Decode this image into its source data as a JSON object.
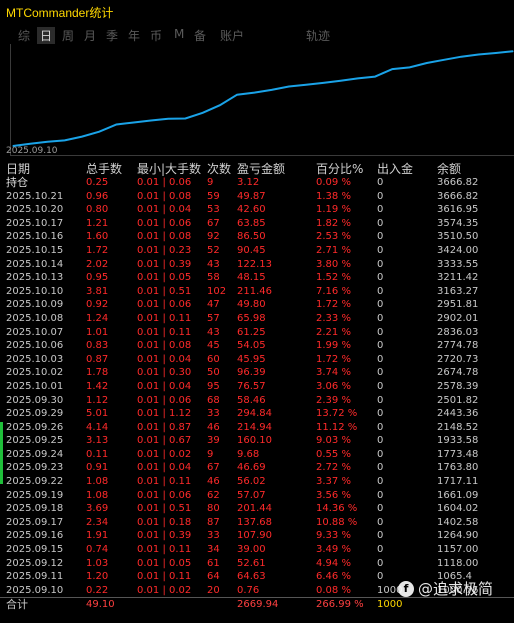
{
  "app": {
    "title": "MTCommander统计"
  },
  "tabs": [
    {
      "label": "综",
      "active": false
    },
    {
      "label": "日",
      "active": true
    },
    {
      "label": "周",
      "active": false
    },
    {
      "label": "月",
      "active": false
    },
    {
      "label": "季",
      "active": false
    },
    {
      "label": "年",
      "active": false
    },
    {
      "label": "币",
      "active": false
    },
    {
      "label": "M",
      "active": false
    },
    {
      "label": "备",
      "active": false
    },
    {
      "label": "账户",
      "active": false
    },
    {
      "label": "轨迹",
      "active": false
    }
  ],
  "chart": {
    "start_date": "2025.09.10",
    "line_color": "#1aa3e8"
  },
  "chart_data": {
    "type": "line",
    "x": [
      "2025.09.10",
      "2025.09.11",
      "2025.09.12",
      "2025.09.15",
      "2025.09.16",
      "2025.09.17",
      "2025.09.18",
      "2025.09.19",
      "2025.09.22",
      "2025.09.23",
      "2025.09.24",
      "2025.09.25",
      "2025.09.26",
      "2025.09.29",
      "2025.09.30",
      "2025.10.01",
      "2025.10.02",
      "2025.10.03",
      "2025.10.06",
      "2025.10.07",
      "2025.10.08",
      "2025.10.09",
      "2025.10.10",
      "2025.10.13",
      "2025.10.14",
      "2025.10.15",
      "2025.10.16",
      "2025.10.17",
      "2025.10.20",
      "2025.10.21"
    ],
    "series": [
      {
        "values": [
          1000.76,
          1065.4,
          1118.0,
          1157.0,
          1264.9,
          1402.58,
          1604.02,
          1661.09,
          1717.11,
          1763.8,
          1773.48,
          1933.58,
          2148.52,
          2443.36,
          2501.82,
          2578.39,
          2674.78,
          2720.73,
          2774.78,
          2836.03,
          2902.01,
          2951.81,
          3163.27,
          3211.42,
          3333.55,
          3424.0,
          3510.5,
          3574.35,
          3616.95,
          3666.82
        ]
      }
    ],
    "ylim": [
      1000,
      3700
    ]
  },
  "table": {
    "headers": {
      "date": "日期",
      "lots": "总手数",
      "range": "最小|大手数",
      "count": "次数",
      "pl": "盈亏金额",
      "pct": "百分比%",
      "io": "出入金",
      "balance": "余额"
    },
    "holding": {
      "label": "持仓",
      "lots": "0.25",
      "range": "0.01 | 0.06",
      "count": "9",
      "pl": "3.12",
      "pct": "0.09 %",
      "io": "0",
      "balance": "3666.82"
    },
    "rows": [
      {
        "date": "2025.10.21",
        "lots": "0.96",
        "range": "0.01 | 0.08",
        "count": "59",
        "pl": "49.87",
        "pct": "1.38 %",
        "io": "0",
        "balance": "3666.82"
      },
      {
        "date": "2025.10.20",
        "lots": "0.80",
        "range": "0.01 | 0.04",
        "count": "53",
        "pl": "42.60",
        "pct": "1.19 %",
        "io": "0",
        "balance": "3616.95"
      },
      {
        "date": "2025.10.17",
        "lots": "1.21",
        "range": "0.01 | 0.06",
        "count": "67",
        "pl": "63.85",
        "pct": "1.82 %",
        "io": "0",
        "balance": "3574.35"
      },
      {
        "date": "2025.10.16",
        "lots": "1.60",
        "range": "0.01 | 0.08",
        "count": "92",
        "pl": "86.50",
        "pct": "2.53 %",
        "io": "0",
        "balance": "3510.50"
      },
      {
        "date": "2025.10.15",
        "lots": "1.72",
        "range": "0.01 | 0.23",
        "count": "52",
        "pl": "90.45",
        "pct": "2.71 %",
        "io": "0",
        "balance": "3424.00"
      },
      {
        "date": "2025.10.14",
        "lots": "2.02",
        "range": "0.01 | 0.39",
        "count": "43",
        "pl": "122.13",
        "pct": "3.80 %",
        "io": "0",
        "balance": "3333.55"
      },
      {
        "date": "2025.10.13",
        "lots": "0.95",
        "range": "0.01 | 0.05",
        "count": "58",
        "pl": "48.15",
        "pct": "1.52 %",
        "io": "0",
        "balance": "3211.42"
      },
      {
        "date": "2025.10.10",
        "lots": "3.81",
        "range": "0.01 | 0.51",
        "count": "102",
        "pl": "211.46",
        "pct": "7.16 %",
        "io": "0",
        "balance": "3163.27"
      },
      {
        "date": "2025.10.09",
        "lots": "0.92",
        "range": "0.01 | 0.06",
        "count": "47",
        "pl": "49.80",
        "pct": "1.72 %",
        "io": "0",
        "balance": "2951.81"
      },
      {
        "date": "2025.10.08",
        "lots": "1.24",
        "range": "0.01 | 0.11",
        "count": "57",
        "pl": "65.98",
        "pct": "2.33 %",
        "io": "0",
        "balance": "2902.01"
      },
      {
        "date": "2025.10.07",
        "lots": "1.01",
        "range": "0.01 | 0.11",
        "count": "43",
        "pl": "61.25",
        "pct": "2.21 %",
        "io": "0",
        "balance": "2836.03"
      },
      {
        "date": "2025.10.06",
        "lots": "0.83",
        "range": "0.01 | 0.08",
        "count": "45",
        "pl": "54.05",
        "pct": "1.99 %",
        "io": "0",
        "balance": "2774.78"
      },
      {
        "date": "2025.10.03",
        "lots": "0.87",
        "range": "0.01 | 0.04",
        "count": "60",
        "pl": "45.95",
        "pct": "1.72 %",
        "io": "0",
        "balance": "2720.73"
      },
      {
        "date": "2025.10.02",
        "lots": "1.78",
        "range": "0.01 | 0.30",
        "count": "50",
        "pl": "96.39",
        "pct": "3.74 %",
        "io": "0",
        "balance": "2674.78"
      },
      {
        "date": "2025.10.01",
        "lots": "1.42",
        "range": "0.01 | 0.04",
        "count": "95",
        "pl": "76.57",
        "pct": "3.06 %",
        "io": "0",
        "balance": "2578.39"
      },
      {
        "date": "2025.09.30",
        "lots": "1.12",
        "range": "0.01 | 0.06",
        "count": "68",
        "pl": "58.46",
        "pct": "2.39 %",
        "io": "0",
        "balance": "2501.82"
      },
      {
        "date": "2025.09.29",
        "lots": "5.01",
        "range": "0.01 | 1.12",
        "count": "33",
        "pl": "294.84",
        "pct": "13.72 %",
        "io": "0",
        "balance": "2443.36"
      },
      {
        "date": "2025.09.26",
        "lots": "4.14",
        "range": "0.01 | 0.87",
        "count": "46",
        "pl": "214.94",
        "pct": "11.12 %",
        "io": "0",
        "balance": "2148.52"
      },
      {
        "date": "2025.09.25",
        "lots": "3.13",
        "range": "0.01 | 0.67",
        "count": "39",
        "pl": "160.10",
        "pct": "9.03 %",
        "io": "0",
        "balance": "1933.58"
      },
      {
        "date": "2025.09.24",
        "lots": "0.11",
        "range": "0.01 | 0.02",
        "count": "9",
        "pl": "9.68",
        "pct": "0.55 %",
        "io": "0",
        "balance": "1773.48"
      },
      {
        "date": "2025.09.23",
        "lots": "0.91",
        "range": "0.01 | 0.04",
        "count": "67",
        "pl": "46.69",
        "pct": "2.72 %",
        "io": "0",
        "balance": "1763.80"
      },
      {
        "date": "2025.09.22",
        "lots": "1.08",
        "range": "0.01 | 0.11",
        "count": "46",
        "pl": "56.02",
        "pct": "3.37 %",
        "io": "0",
        "balance": "1717.11"
      },
      {
        "date": "2025.09.19",
        "lots": "1.08",
        "range": "0.01 | 0.06",
        "count": "62",
        "pl": "57.07",
        "pct": "3.56 %",
        "io": "0",
        "balance": "1661.09"
      },
      {
        "date": "2025.09.18",
        "lots": "3.69",
        "range": "0.01 | 0.51",
        "count": "80",
        "pl": "201.44",
        "pct": "14.36 %",
        "io": "0",
        "balance": "1604.02"
      },
      {
        "date": "2025.09.17",
        "lots": "2.34",
        "range": "0.01 | 0.18",
        "count": "87",
        "pl": "137.68",
        "pct": "10.88 %",
        "io": "0",
        "balance": "1402.58"
      },
      {
        "date": "2025.09.16",
        "lots": "1.91",
        "range": "0.01 | 0.39",
        "count": "33",
        "pl": "107.90",
        "pct": "9.33 %",
        "io": "0",
        "balance": "1264.90"
      },
      {
        "date": "2025.09.15",
        "lots": "0.74",
        "range": "0.01 | 0.11",
        "count": "34",
        "pl": "39.00",
        "pct": "3.49 %",
        "io": "0",
        "balance": "1157.00"
      },
      {
        "date": "2025.09.12",
        "lots": "1.03",
        "range": "0.01 | 0.05",
        "count": "61",
        "pl": "52.61",
        "pct": "4.94 %",
        "io": "0",
        "balance": "1118.00"
      },
      {
        "date": "2025.09.11",
        "lots": "1.20",
        "range": "0.01 | 0.11",
        "count": "64",
        "pl": "64.63",
        "pct": "6.46 %",
        "io": "0",
        "balance": "1065.4"
      },
      {
        "date": "2025.09.10",
        "lots": "0.22",
        "range": "0.01 | 0.02",
        "count": "20",
        "pl": "0.76",
        "pct": "0.08 %",
        "io": "1000",
        "balance": "1000.76"
      }
    ],
    "total": {
      "label": "合计",
      "lots": "49.10",
      "pl": "2669.94",
      "pct": "266.99 %",
      "io": "1000"
    }
  },
  "watermark": {
    "text": "@追求极简"
  }
}
